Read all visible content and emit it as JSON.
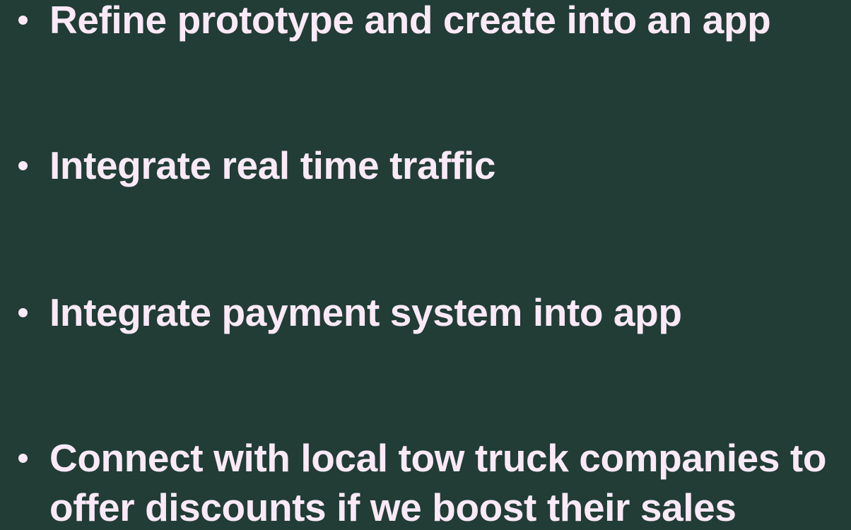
{
  "slide": {
    "text_color": "#fbe9f7",
    "background_color": "#213d35",
    "bullets": [
      {
        "text": "Refine prototype and create into an app"
      },
      {
        "text": "Integrate real time traffic"
      },
      {
        "text": "Integrate payment system into app"
      },
      {
        "text": "Connect with local tow truck companies to offer discounts if we boost their sales"
      }
    ]
  }
}
